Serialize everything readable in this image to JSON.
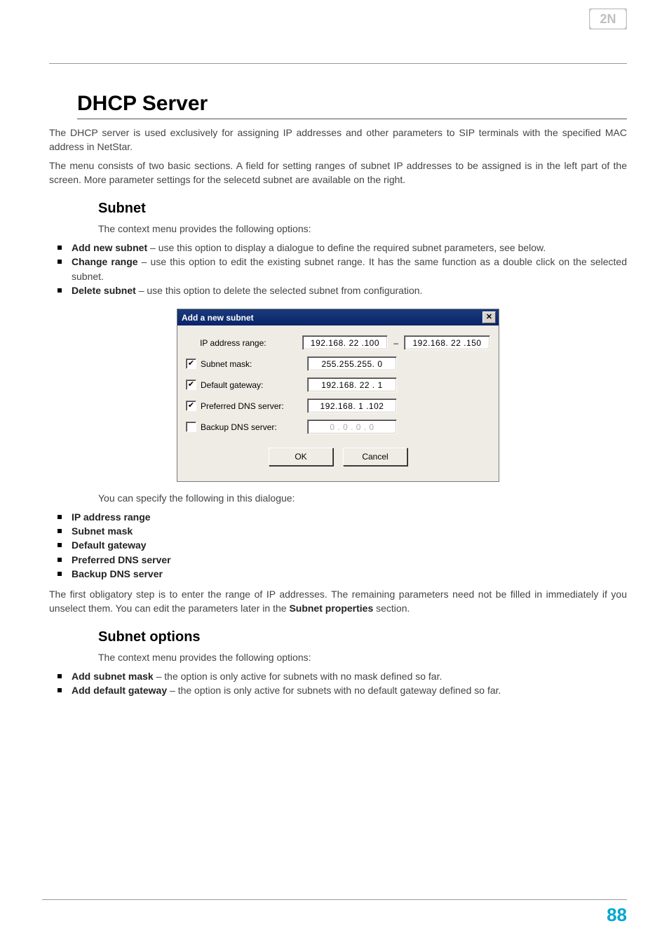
{
  "header": {
    "logo_alt": "2N"
  },
  "page": {
    "title": "DHCP Server",
    "intro_p1": "The DHCP server is used exclusively for assigning IP addresses and other parameters to SIP terminals with the specified MAC address in NetStar.",
    "intro_p2": "The menu consists of two basic sections. A field for setting ranges of subnet IP addresses to be assigned is in the left part of the screen. More parameter settings for the selecetd subnet are available on the right."
  },
  "subnet": {
    "heading": "Subnet",
    "lead": "The context menu provides the following options:",
    "items": [
      {
        "label": "Add new subnet",
        "text": " – use this option to display a dialogue to define the required subnet parameters, see below."
      },
      {
        "label": "Change range",
        "text": " – use this option to edit the existing subnet range. It has the same function as a double click on the selected subnet."
      },
      {
        "label": "Delete subnet",
        "text": " – use this option to delete the selected subnet from configuration."
      }
    ]
  },
  "dialog": {
    "title": "Add a new subnet",
    "close_glyph": "✕",
    "rows": {
      "ip_range_label": "IP address range:",
      "ip_from": "192.168. 22 .100",
      "ip_to": "192.168. 22 .150",
      "dash": "–",
      "mask_label": "Subnet mask:",
      "mask_val": "255.255.255.  0",
      "gw_label": "Default gateway:",
      "gw_val": "192.168. 22 .  1",
      "dns1_label": "Preferred DNS server:",
      "dns1_val": "192.168.  1 .102",
      "dns2_label": "Backup DNS server:",
      "dns2_val": "0 . 0 . 0 . 0"
    },
    "ok": "OK",
    "cancel": "Cancel",
    "check_glyph": "✔"
  },
  "dialog_followup": {
    "lead": "You can specify the following in this dialogue:",
    "items": [
      "IP address range",
      "Subnet mask",
      "Default gateway",
      "Preferred DNS server",
      "Backup DNS server"
    ],
    "tail_pre": "The first obligatory step is to enter the range of IP addresses. The remaining parameters need not be filled in immediately if you unselect them. You can edit the parameters later in the ",
    "tail_bold": "Subnet properties",
    "tail_post": " section."
  },
  "subnet_options": {
    "heading": "Subnet options",
    "lead": "The context menu provides the following options:",
    "items": [
      {
        "label": "Add subnet mask",
        "text": " – the option is only active for subnets with no mask defined so far."
      },
      {
        "label": "Add default gateway",
        "text": " – the option is only active for subnets with no default gateway defined so far."
      }
    ]
  },
  "footer": {
    "page_number": "88"
  }
}
